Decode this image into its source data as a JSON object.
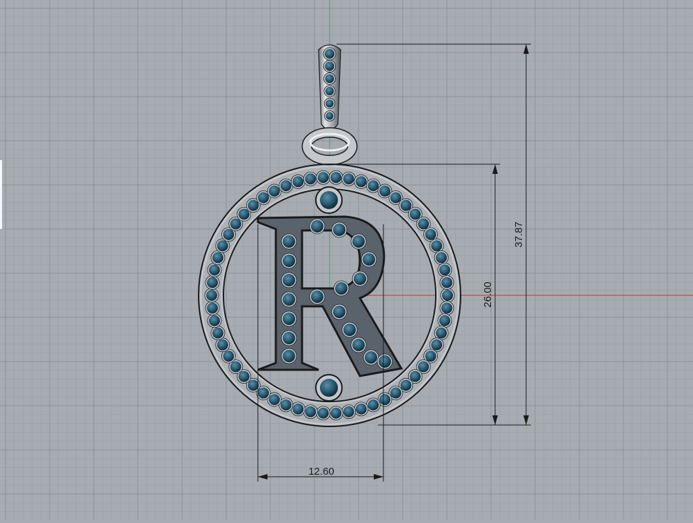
{
  "viewport": {
    "name": "Front",
    "background": "#a7acb3",
    "grid_minor_color": "#9ba0a7",
    "grid_major_color": "#8d9299",
    "x_axis_color": "#c0392b",
    "y_axis_color": "#3fae49"
  },
  "model": {
    "metal_color": "#c4c7cc",
    "stone_color": "#1f4f66",
    "outline_color": "#1a1a1a"
  },
  "dimensions": {
    "total_height": "37.87",
    "ring_height": "26.00",
    "letter_width": "12.60"
  }
}
